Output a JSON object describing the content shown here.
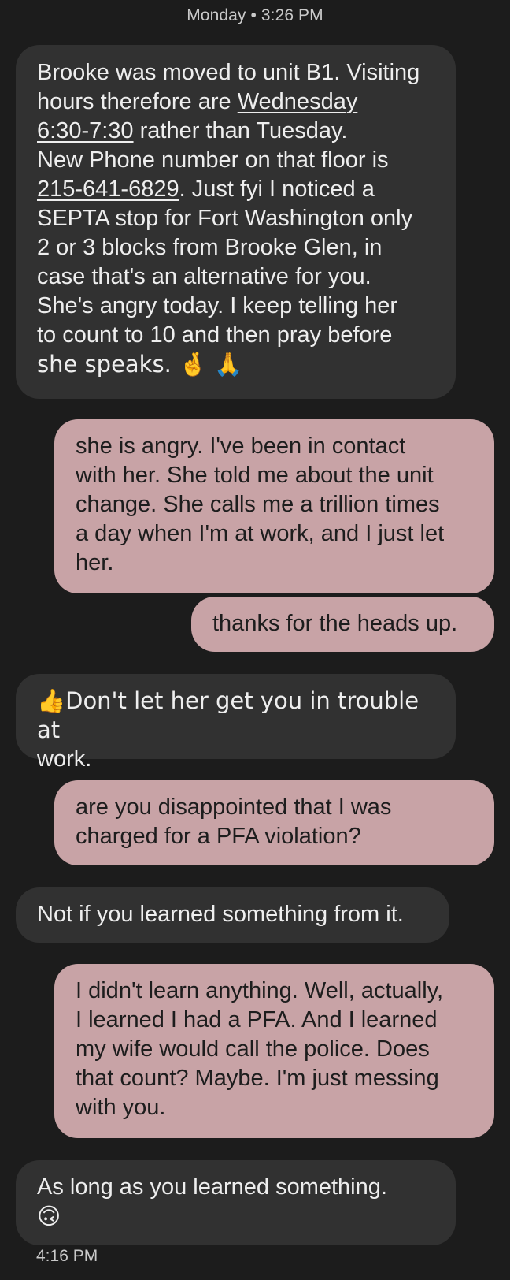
{
  "header": {
    "timestamp": "Monday • 3:26 PM"
  },
  "messages": [
    {
      "direction": "incoming",
      "lines": [
        "Brooke was moved to unit B1. Visiting",
        "hours therefore are ",
        "Wednesday",
        "6:30-7:30",
        " rather than Tuesday.",
        "New Phone number on that floor is",
        "215-641-6829",
        ". Just fyi I noticed a",
        "SEPTA stop for Fort Washington only",
        "2 or 3 blocks from Brooke Glen, in",
        "case that's an alternative for you.",
        "She's angry today. I keep telling her",
        "to count to 10 and then pray before",
        "she speaks. 🤞 🙏"
      ]
    },
    {
      "direction": "outgoing",
      "lines": [
        "she is angry. I've been in contact",
        "with her. She told me about the unit",
        "change. She calls me a trillion times",
        "a day when I'm at work, and I just let",
        "her."
      ]
    },
    {
      "direction": "outgoing",
      "lines": [
        "thanks for the heads up."
      ]
    },
    {
      "direction": "incoming",
      "lines": [
        "👍Don't let her get you in trouble at",
        "work."
      ]
    },
    {
      "direction": "outgoing",
      "lines": [
        "are you disappointed that I was",
        "charged for a PFA violation?"
      ]
    },
    {
      "direction": "incoming",
      "lines": [
        "Not if you learned something from it."
      ]
    },
    {
      "direction": "outgoing",
      "lines": [
        "I didn't learn anything. Well, actually,",
        "I learned I had a PFA. And I learned",
        "my wife would call the police. Does",
        "that count? Maybe. I'm just messing",
        "with you."
      ]
    },
    {
      "direction": "incoming",
      "lines": [
        "As long as you learned something.",
        "🙃"
      ]
    }
  ],
  "footer": {
    "timestamp": "4:16 PM"
  }
}
